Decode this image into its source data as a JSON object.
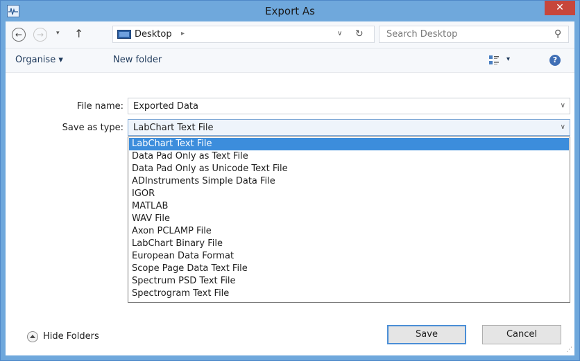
{
  "window": {
    "title": "Export As",
    "close_glyph": "✕"
  },
  "address_bar": {
    "back_glyph": "←",
    "forward_glyph": "→",
    "recent_glyph": "▾",
    "up_glyph": "↑",
    "location": "Desktop",
    "path_separator": "▸",
    "dropdown_glyph": "∨",
    "refresh_glyph": "↻",
    "search_placeholder": "Search Desktop",
    "search_glyph": "⚲"
  },
  "toolbar": {
    "organise_label": "Organise ▾",
    "new_folder_label": "New folder",
    "view_dropdown_glyph": "▾",
    "help_glyph": "?"
  },
  "form": {
    "file_name_label": "File name:",
    "file_name_value": "Exported Data",
    "save_as_type_label": "Save as type:",
    "save_as_type_value": "LabChart Text File",
    "chevron_glyph": "∨"
  },
  "type_options": [
    {
      "label": "LabChart Text File",
      "selected": true
    },
    {
      "label": "Data Pad Only as Text File",
      "selected": false
    },
    {
      "label": "Data Pad Only as Unicode Text File",
      "selected": false
    },
    {
      "label": "ADInstruments Simple Data File",
      "selected": false
    },
    {
      "label": "IGOR",
      "selected": false
    },
    {
      "label": "MATLAB",
      "selected": false
    },
    {
      "label": "WAV File",
      "selected": false
    },
    {
      "label": "Axon PCLAMP File",
      "selected": false
    },
    {
      "label": "LabChart Binary File",
      "selected": false
    },
    {
      "label": "European Data Format",
      "selected": false
    },
    {
      "label": "Scope Page Data Text File",
      "selected": false
    },
    {
      "label": "Spectrum PSD Text File",
      "selected": false
    },
    {
      "label": "Spectrogram Text File",
      "selected": false
    }
  ],
  "footer": {
    "hide_folders_label": "Hide Folders",
    "save_label": "Save",
    "cancel_label": "Cancel"
  },
  "colors": {
    "title_bar": "#6fa8dc",
    "close_button": "#c7463b",
    "selection": "#3c8ddc"
  }
}
